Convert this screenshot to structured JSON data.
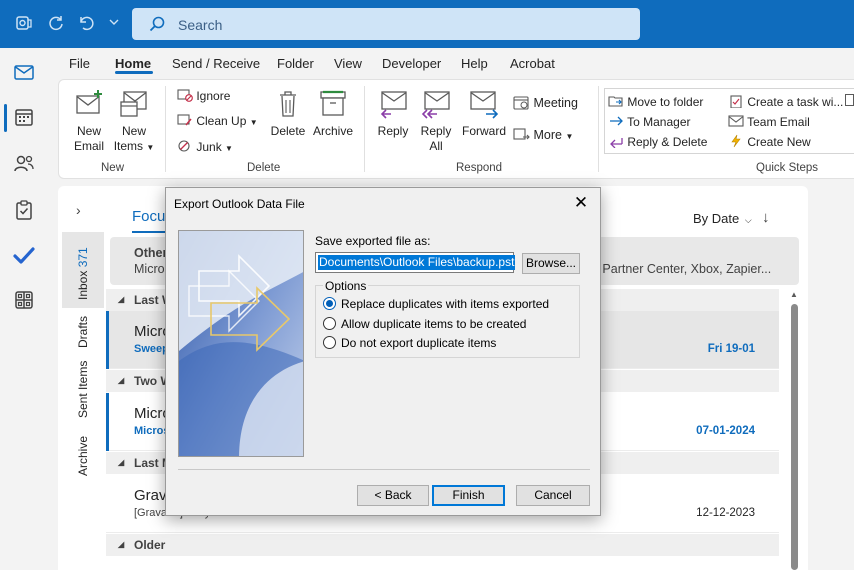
{
  "titlebar": {
    "search_placeholder": "Search"
  },
  "menu": {
    "tabs": [
      "File",
      "Home",
      "Send / Receive",
      "Folder",
      "View",
      "Developer",
      "Help",
      "Acrobat"
    ],
    "active": "Home"
  },
  "ribbon": {
    "new_email": "New\nEmail",
    "new_email_l1": "New",
    "new_email_l2": "Email",
    "new_items_l1": "New",
    "new_items_l2": "Items",
    "group_new": "New",
    "ignore": "Ignore",
    "clean_up": "Clean Up",
    "junk": "Junk",
    "delete": "Delete",
    "archive": "Archive",
    "group_delete": "Delete",
    "reply": "Reply",
    "reply_all_l1": "Reply",
    "reply_all_l2": "All",
    "forward": "Forward",
    "meeting": "Meeting",
    "more": "More",
    "group_respond": "Respond",
    "qs_move_to_folder": "Move to folder",
    "qs_to_manager": "To Manager",
    "qs_reply_delete": "Reply & Delete",
    "qs_create_task": "Create a task wi...",
    "qs_team_email": "Team Email",
    "qs_create_new": "Create New",
    "group_quick_steps": "Quick Steps"
  },
  "folders": {
    "inbox": "Inbox",
    "inbox_count": "371",
    "drafts": "Drafts",
    "sent": "Sent Items",
    "archive": "Archive"
  },
  "maillist": {
    "focused_tab": "Focus",
    "sort": "By Date",
    "other_title": "Other",
    "other_sub_left": "Micros",
    "other_sub_right": "ft Partner Center, Xbox, Zapier...",
    "groups": [
      "Last W",
      "Two W",
      "Last M",
      "Older"
    ],
    "items": [
      {
        "sender": "Micro",
        "subject": "Sweep",
        "date": "Fri 19-01"
      },
      {
        "sender": "Micro",
        "subject": "Micros",
        "date": "07-01-2024"
      },
      {
        "sender": "Grava",
        "subject": "[Gravatar] Terry email addition",
        "date": "12-12-2023"
      }
    ]
  },
  "dialog": {
    "title": "Export Outlook Data File",
    "save_label": "Save exported file as:",
    "file_path": "Documents\\Outlook Files\\backup.pst",
    "browse": "Browse...",
    "options_legend": "Options",
    "opt_replace": "Replace duplicates with items exported",
    "opt_allow": "Allow duplicate items to be created",
    "opt_dont": "Do not export duplicate items",
    "selected_option": "opt_replace",
    "back": "< Back",
    "finish": "Finish",
    "cancel": "Cancel"
  },
  "colors": {
    "brand": "#0f6cbd",
    "selection": "#0078d7"
  }
}
